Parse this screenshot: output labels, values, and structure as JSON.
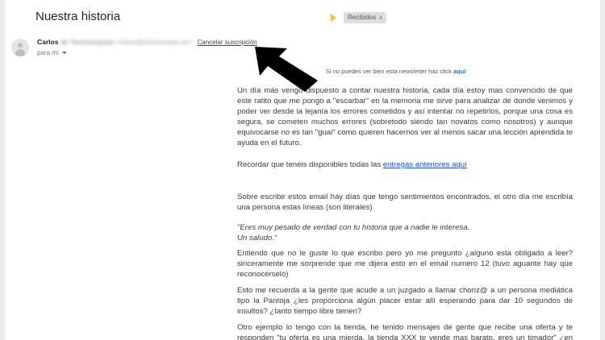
{
  "email": {
    "subject": "Nuestra historia",
    "label": "Recibidos",
    "label_close": "x",
    "importance_color": "#f3c13d",
    "sender": {
      "name": "Carlos",
      "name_blurred": "de Techmospain",
      "email_blurred": "<carlos@techmospain.es>",
      "unsubscribe": "Cancelar suscripción",
      "to": "para mí"
    },
    "avatar_icon": "default-user-avatar-icon",
    "annotation_arrow": "pointer-arrow-icon"
  },
  "newsletter": {
    "prompt": "Si no puedes ver bien esta newsletter haz click",
    "link": "aquí"
  },
  "body": {
    "p1": "Un día más vengo dispuesto a contar nuestra historia, cada día estoy mas convencido de que este ratito que me pongo a \"escarbar\" en la memoria me sirve para analizar de donde venimos y poder ver desde la lejanía los errores cometidos y así intentar no repetirlos, porque una cosa es segura, se cometen muchos errores (sobretodo siendo tan novatos como nosotros) y aunque equivocarse no es tan \"guai\" como quieren hacernos ver al menos sacar una lección aprendida te ayuda en el futuro.",
    "p2_prefix": "Recordar que tenéis disponibles todas las ",
    "p2_link": "entregas anteriores aquí",
    "p3": "Sobre escribir estos email hay días que tengo sentimientos encontrados, el otro día me escribía una persona estas líneas (son literales)",
    "quote_line1": "\"Eres muy pesado de verdad con tu historia que a nadie le interesa.",
    "quote_line2": "Un saludo.\"",
    "p4": "Entiendo que no le guste lo que escribo pero yo me pregunto ¿alguno esta obligado a leer? sinceramente me sorprende que me dijera esto en el email numero 12 (tuvo aguante hay que reconocérselo)",
    "p5": "Esto me recuerda a la gente que acude a un juzgado a llamar choriz@ a un persona mediática tipo la Pantoja ¿les proporciona algún placer estar allí esperando para dar 10 segundos de insultos? ¿tanto tiempo libre tienen?",
    "p6": "Otro ejemplo lo tengo con la tienda, he tenido mensajes de gente que recibe una oferta y te responden \"tu oferta es una mierda, la tienda XXX te vende mas barato, eres un timador\" ¿en serio? ¿timador? me parto..."
  }
}
